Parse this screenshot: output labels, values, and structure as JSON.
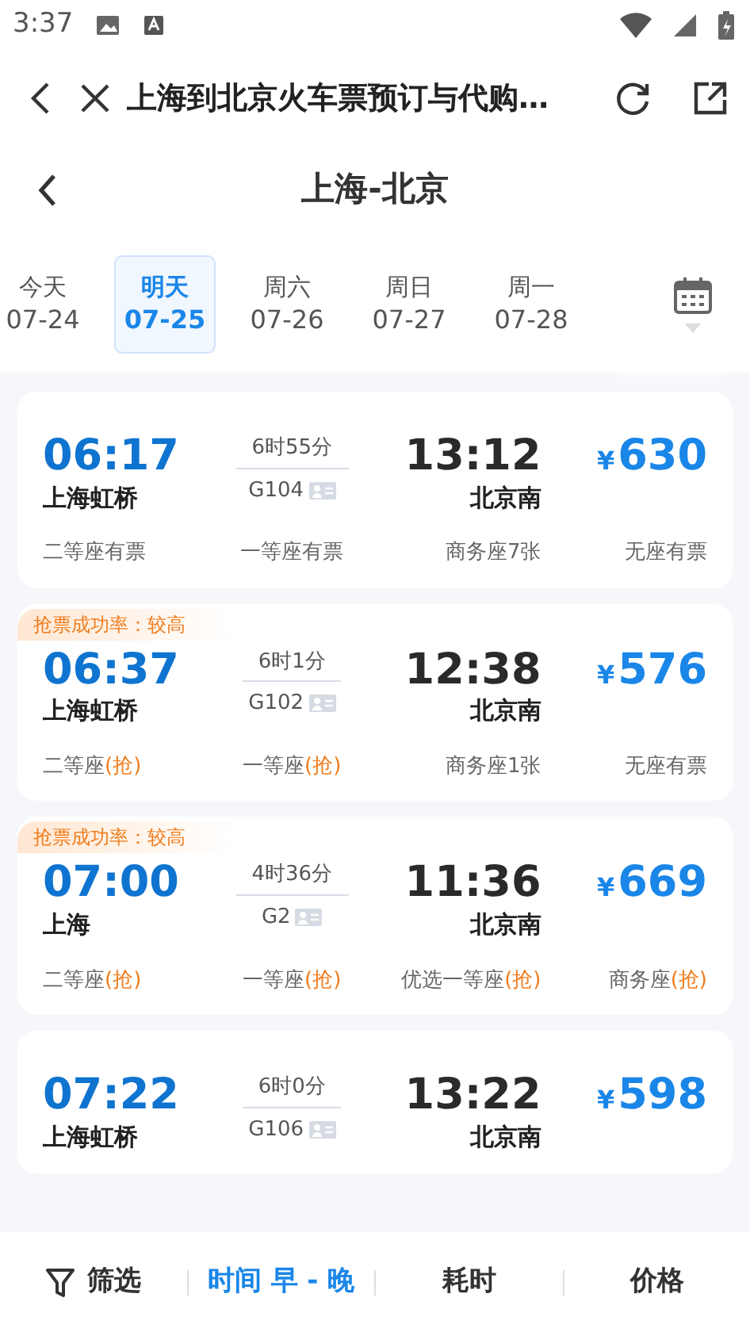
{
  "status_bar": {
    "time": "3:37"
  },
  "browser_bar": {
    "title": "上海到北京火车票预订与代购…"
  },
  "header": {
    "title": "上海-北京"
  },
  "dates": [
    {
      "weekday": "今天",
      "date": "07-24",
      "selected": false
    },
    {
      "weekday": "明天",
      "date": "07-25",
      "selected": true
    },
    {
      "weekday": "周六",
      "date": "07-26",
      "selected": false
    },
    {
      "weekday": "周日",
      "date": "07-27",
      "selected": false
    },
    {
      "weekday": "周一",
      "date": "07-28",
      "selected": false
    }
  ],
  "trains": [
    {
      "depart_time": "06:17",
      "depart_station": "上海虹桥",
      "duration": "6时55分",
      "number": "G104",
      "arrive_time": "13:12",
      "arrive_station": "北京南",
      "currency": "¥",
      "price": "630",
      "seats": [
        {
          "text": "二等座有票"
        },
        {
          "text": "一等座有票"
        },
        {
          "text": "商务座7张"
        },
        {
          "text": "无座有票"
        }
      ]
    },
    {
      "tag": "抢票成功率：较高",
      "depart_time": "06:37",
      "depart_station": "上海虹桥",
      "duration": "6时1分",
      "number": "G102",
      "arrive_time": "12:38",
      "arrive_station": "北京南",
      "currency": "¥",
      "price": "576",
      "seats": [
        {
          "text": "二等座",
          "grab": "(抢)"
        },
        {
          "text": "一等座",
          "grab": "(抢)"
        },
        {
          "text": "商务座1张"
        },
        {
          "text": "无座有票"
        }
      ]
    },
    {
      "tag": "抢票成功率：较高",
      "depart_time": "07:00",
      "depart_station": "上海",
      "duration": "4时36分",
      "number": "G2",
      "arrive_time": "11:36",
      "arrive_station": "北京南",
      "currency": "¥",
      "price": "669",
      "seats": [
        {
          "text": "二等座",
          "grab": "(抢)"
        },
        {
          "text": "一等座",
          "grab": "(抢)"
        },
        {
          "text": "优选一等座",
          "grab": "(抢)"
        },
        {
          "text": "商务座",
          "grab": "(抢)"
        }
      ]
    },
    {
      "depart_time": "07:22",
      "depart_station": "上海虹桥",
      "duration": "6时0分",
      "number": "G106",
      "arrive_time": "13:22",
      "arrive_station": "北京南",
      "currency": "¥",
      "price": "598"
    }
  ],
  "sort_bar": [
    {
      "kind": "filter",
      "label": "筛选",
      "selected": false
    },
    {
      "kind": "sort",
      "label": "时间 早 - 晚",
      "selected": true
    },
    {
      "kind": "sort",
      "label": "耗时",
      "selected": false
    },
    {
      "kind": "sort",
      "label": "价格",
      "selected": false
    }
  ]
}
